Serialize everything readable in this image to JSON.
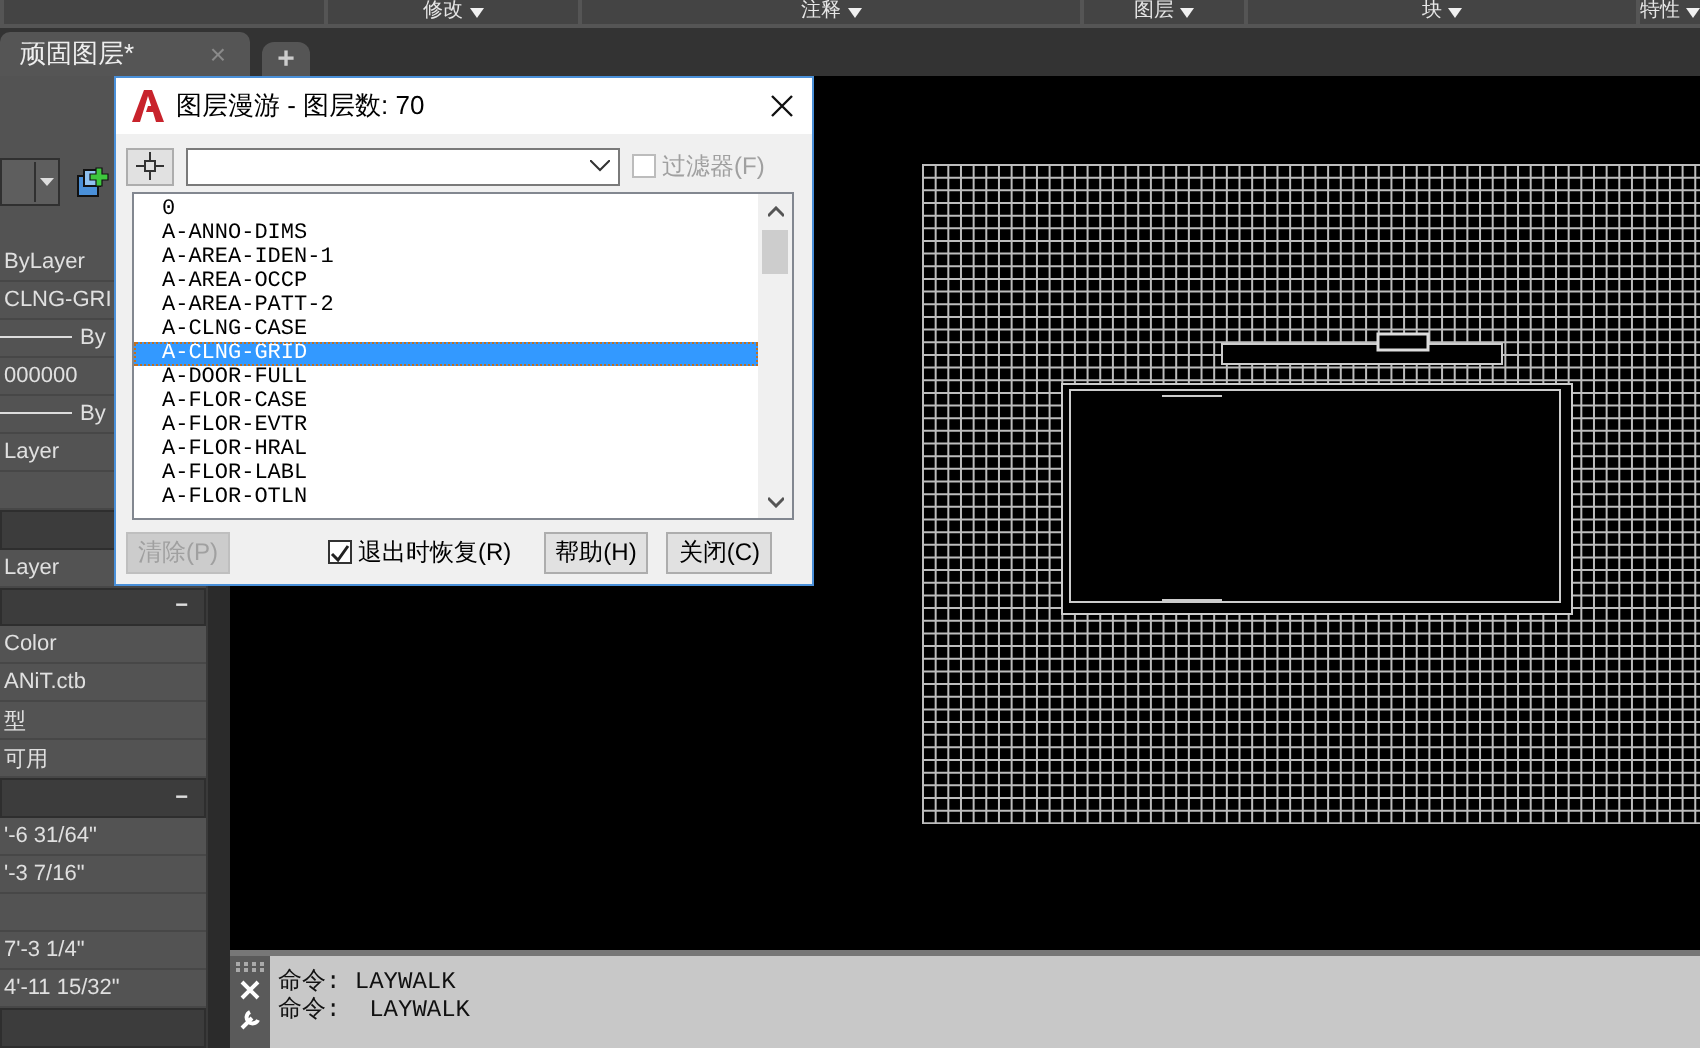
{
  "ribbon": {
    "panels": [
      "修改",
      "注释",
      "图层",
      "块",
      "特性"
    ]
  },
  "tabs": [
    {
      "label": "顽固图层*",
      "close": "×",
      "selected": true
    }
  ],
  "new_tab": "+",
  "palette": {
    "rows": [
      {
        "kind": "dropdown"
      },
      {
        "kind": "value",
        "text": "ByLayer"
      },
      {
        "kind": "value",
        "text": "CLNG-GRI"
      },
      {
        "kind": "line-value",
        "text": "By"
      },
      {
        "kind": "value",
        "text": "000000"
      },
      {
        "kind": "line-value",
        "text": "By"
      },
      {
        "kind": "value",
        "text": "Layer"
      },
      {
        "kind": "blank"
      },
      {
        "kind": "header"
      },
      {
        "kind": "value",
        "text": "Layer"
      },
      {
        "kind": "header",
        "text": "−"
      },
      {
        "kind": "value",
        "text": "Color"
      },
      {
        "kind": "value",
        "text": "ANiT.ctb"
      },
      {
        "kind": "value",
        "text": "型"
      },
      {
        "kind": "value",
        "text": "可用"
      },
      {
        "kind": "header",
        "text": "−"
      },
      {
        "kind": "value",
        "text": "'-6 31/64\""
      },
      {
        "kind": "value",
        "text": "'-3 7/16\""
      },
      {
        "kind": "blank"
      },
      {
        "kind": "value",
        "text": "7'-3 1/4\""
      },
      {
        "kind": "value",
        "text": "4'-11 15/32\""
      },
      {
        "kind": "header"
      }
    ]
  },
  "dialog": {
    "title": "图层漫游 - 图层数: 70",
    "filter": {
      "label": "过滤器(F)",
      "checked": false,
      "disabled": true
    },
    "layers": [
      {
        "name": "0",
        "selected": false
      },
      {
        "name": "A-ANNO-DIMS",
        "selected": false
      },
      {
        "name": "A-AREA-IDEN-1",
        "selected": false
      },
      {
        "name": "A-AREA-OCCP",
        "selected": false
      },
      {
        "name": "A-AREA-PATT-2",
        "selected": false
      },
      {
        "name": "A-CLNG-CASE",
        "selected": false
      },
      {
        "name": "A-CLNG-GRID",
        "selected": true
      },
      {
        "name": "A-DOOR-FULL",
        "selected": false
      },
      {
        "name": "A-FLOR-CASE",
        "selected": false
      },
      {
        "name": "A-FLOR-EVTR",
        "selected": false
      },
      {
        "name": "A-FLOR-HRAL",
        "selected": false
      },
      {
        "name": "A-FLOR-LABL",
        "selected": false
      },
      {
        "name": "A-FLOR-OTLN",
        "selected": false
      }
    ],
    "footer": [
      {
        "kind": "button",
        "label": "清除(P)",
        "disabled": true
      },
      {
        "kind": "checkbox",
        "label": "退出时恢复(R)",
        "checked": true
      },
      {
        "kind": "button",
        "label": "帮助(H)",
        "disabled": false
      },
      {
        "kind": "button",
        "label": "关闭(C)",
        "disabled": false
      }
    ]
  },
  "command_line": {
    "lines": [
      "命令: LAYWALK",
      "命令:  LAYWALK"
    ]
  }
}
